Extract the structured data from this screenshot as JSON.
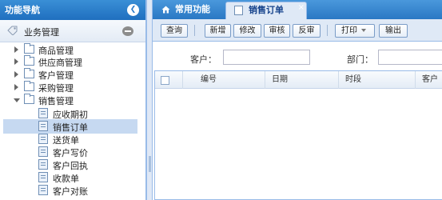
{
  "sidebar": {
    "title": "功能导航",
    "group": {
      "label": "业务管理"
    },
    "items": [
      {
        "label": "商品管理",
        "type": "folder",
        "expanded": false
      },
      {
        "label": "供应商管理",
        "type": "folder",
        "expanded": false
      },
      {
        "label": "客户管理",
        "type": "folder",
        "expanded": false
      },
      {
        "label": "采购管理",
        "type": "folder",
        "expanded": false
      },
      {
        "label": "销售管理",
        "type": "folder",
        "expanded": true
      },
      {
        "label": "应收期初",
        "type": "doc"
      },
      {
        "label": "销售订单",
        "type": "doc",
        "selected": true
      },
      {
        "label": "送货单",
        "type": "doc"
      },
      {
        "label": "客户写价",
        "type": "doc"
      },
      {
        "label": "客户回执",
        "type": "doc"
      },
      {
        "label": "收款单",
        "type": "doc"
      },
      {
        "label": "客户对账",
        "type": "doc"
      }
    ]
  },
  "tabs": {
    "home": "常用功能",
    "active": "销售订单",
    "close": "×"
  },
  "toolbar": {
    "query": "查询",
    "add": "新增",
    "edit": "修改",
    "audit": "审核",
    "unaudit": "反审",
    "print": "打印",
    "export": "输出"
  },
  "form": {
    "customer_label": "客户：",
    "customer_value": "",
    "dept_label": "部门：",
    "dept_value": ""
  },
  "grid": {
    "columns": [
      "编号",
      "日期",
      "时段",
      "客户"
    ]
  },
  "colors": {
    "header_blue": "#2a78c4",
    "panel_light": "#dfe9f6",
    "selected_row": "#c6d9f1"
  }
}
